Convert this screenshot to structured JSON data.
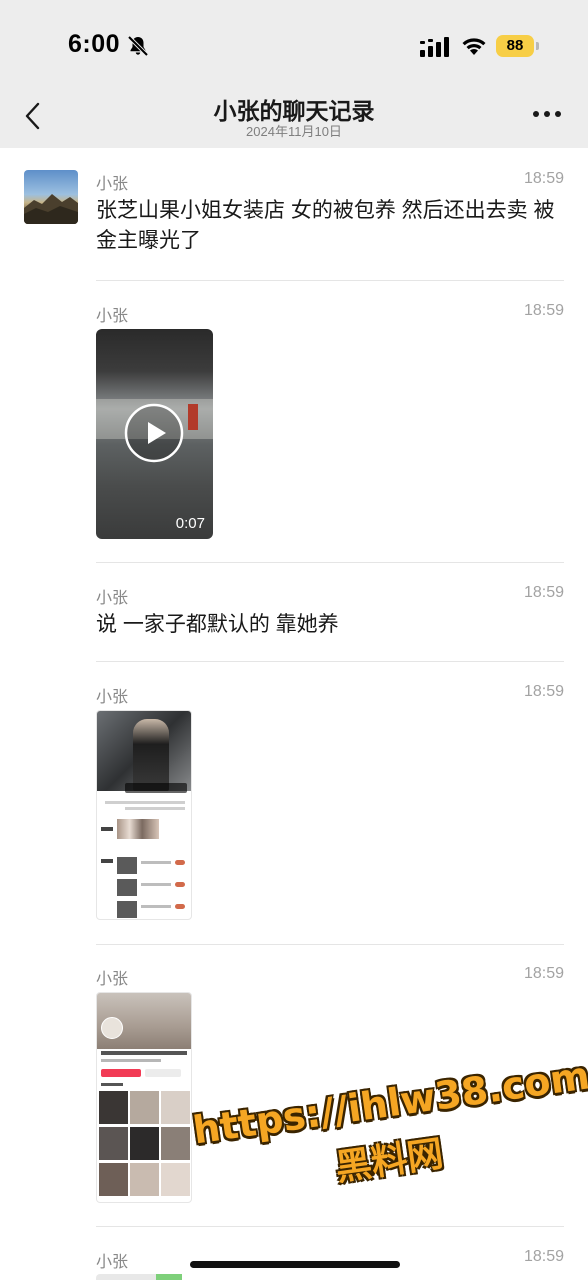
{
  "status_bar": {
    "time": "6:00",
    "battery": "88",
    "icons": [
      "bell-slash-icon",
      "signal-icon",
      "wifi-icon",
      "battery-icon"
    ]
  },
  "header": {
    "title": "小张的聊天记录",
    "subtitle": "2024年11月10日",
    "back_icon": "chevron-left-icon",
    "more_icon": "more-icon"
  },
  "messages": [
    {
      "sender": "小张",
      "time": "18:59",
      "type": "text",
      "text": "张芝山果小姐女装店 女的被包养 然后还出去卖 被金主曝光了"
    },
    {
      "sender": "小张",
      "time": "18:59",
      "type": "video",
      "duration": "0:07"
    },
    {
      "sender": "小张",
      "time": "18:59",
      "type": "text",
      "text": "说 一家子都默认的 靠她养"
    },
    {
      "sender": "小张",
      "time": "18:59",
      "type": "image"
    },
    {
      "sender": "小张",
      "time": "18:59",
      "type": "image"
    },
    {
      "sender": "小张",
      "time": "18:59",
      "type": "image"
    }
  ],
  "watermark": {
    "line1": "https://ihlw38.com",
    "line2": "黑料网"
  },
  "colors": {
    "header_bg": "#ededed",
    "battery": "#f7ce46",
    "watermark": "#f5a623"
  }
}
